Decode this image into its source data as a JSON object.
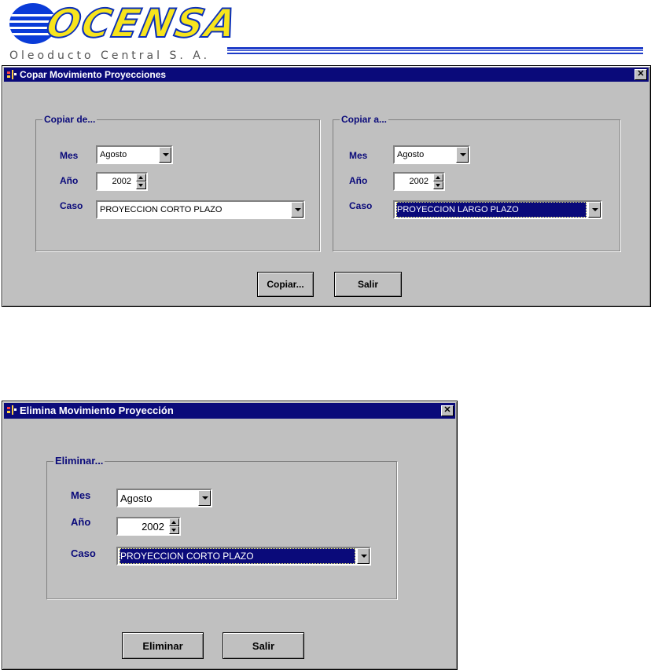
{
  "logo": {
    "brand": "OCENSA",
    "subtitle": "Oleoducto Central S. A."
  },
  "copy_dialog": {
    "title": "Copar Movimiento Proyecciones",
    "close_label": "✕",
    "from_group": {
      "label": "Copiar de...",
      "mes_label": "Mes",
      "mes_value": "Agosto",
      "anio_label": "Año",
      "anio_value": "2002",
      "caso_label": "Caso",
      "caso_value": "PROYECCION CORTO PLAZO"
    },
    "to_group": {
      "label": "Copiar a...",
      "mes_label": "Mes",
      "mes_value": "Agosto",
      "anio_label": "Año",
      "anio_value": "2002",
      "caso_label": "Caso",
      "caso_value": "PROYECCION LARGO PLAZO"
    },
    "copy_button": "Copiar...",
    "exit_button": "Salir"
  },
  "delete_dialog": {
    "title": "Elimina Movimiento Proyección",
    "close_label": "✕",
    "group": {
      "label": "Eliminar...",
      "mes_label": "Mes",
      "mes_value": "Agosto",
      "anio_label": "Año",
      "anio_value": "2002",
      "caso_label": "Caso",
      "caso_value": "PROYECCION CORTO PLAZO"
    },
    "delete_button": "Eliminar",
    "exit_button": "Salir"
  },
  "colors": {
    "titlebar": "#0a0a7a",
    "label": "#0a0a7a",
    "window": "#c0c0c0",
    "logo_blue": "#0a3bd8",
    "logo_yellow": "#f7e41c"
  }
}
